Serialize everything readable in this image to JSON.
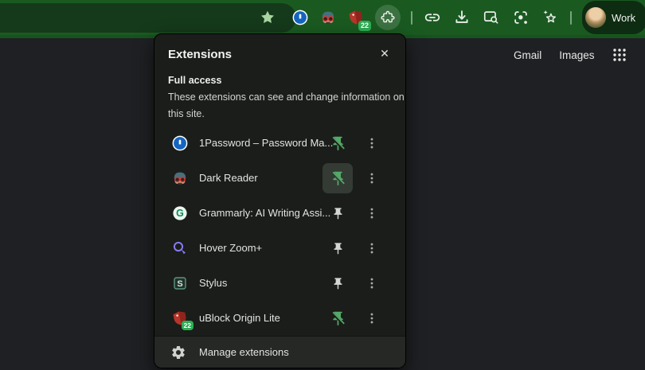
{
  "theme": {
    "toolbar_green": "#1a5a21",
    "omnibox_green": "#15391b",
    "accent_green": "#55a968",
    "badge_green": "#2fae55",
    "panel_bg": "#1b1d1a",
    "manage_row_bg": "#262826",
    "page_bg": "#1e2023"
  },
  "toolbar": {
    "bookmark_star_icon": "bookmark-star-icon",
    "extension_icons": [
      {
        "icon": "1password-icon",
        "active": false
      },
      {
        "icon": "dark-reader-icon",
        "active": false
      },
      {
        "icon": "ublock-icon",
        "badge": "22",
        "active": false
      },
      {
        "icon": "puzzle-icon",
        "active": true
      }
    ],
    "action_icons": [
      {
        "icon": "link-icon"
      },
      {
        "icon": "download-icon"
      },
      {
        "icon": "page-search-icon"
      },
      {
        "icon": "lens-icon"
      },
      {
        "icon": "sparkle-star-icon"
      }
    ],
    "profile": {
      "label": "Work",
      "avatar_icon": "avatar"
    }
  },
  "page": {
    "links": [
      {
        "label": "Gmail"
      },
      {
        "label": "Images"
      }
    ],
    "apps_grid_icon": "apps-grid-icon"
  },
  "panel": {
    "title": "Extensions",
    "close_glyph": "✕",
    "section_title": "Full access",
    "description": "These extensions can see and change information on this site.",
    "extensions": [
      {
        "name": "1Password – Password Ma...",
        "icon": "1password-icon",
        "pinned": true,
        "highlighted": false
      },
      {
        "name": "Dark Reader",
        "icon": "dark-reader-icon",
        "pinned": true,
        "highlighted": true
      },
      {
        "name": "Grammarly: AI Writing Assi...",
        "icon": "grammarly-icon",
        "pinned": false,
        "highlighted": false
      },
      {
        "name": "Hover Zoom+",
        "icon": "hover-zoom-icon",
        "pinned": false,
        "highlighted": false
      },
      {
        "name": "Stylus",
        "icon": "stylus-icon",
        "pinned": false,
        "highlighted": false
      },
      {
        "name": "uBlock Origin Lite",
        "icon": "ublock-icon",
        "badge": "22",
        "pinned": true,
        "highlighted": false
      }
    ],
    "manage_label": "Manage extensions",
    "manage_icon": "gear-icon"
  }
}
